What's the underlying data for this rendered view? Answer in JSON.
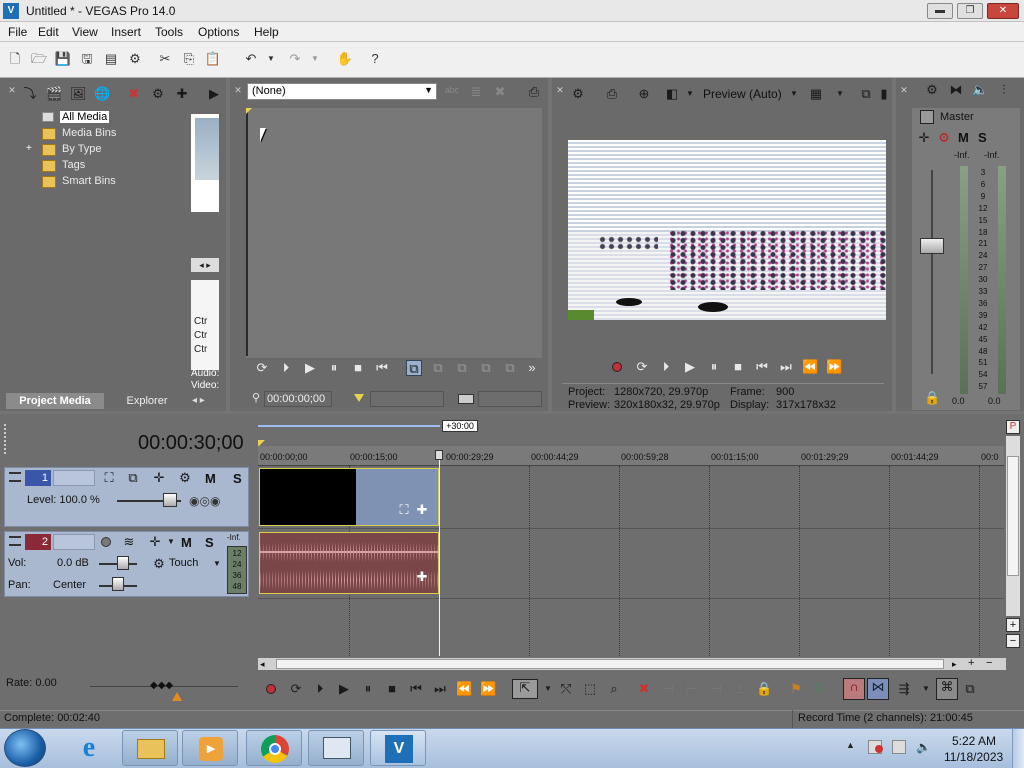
{
  "window": {
    "title": "Untitled * - VEGAS Pro 14.0",
    "logo": "V",
    "min": "▬",
    "max": "❐",
    "close": "✕"
  },
  "menu": [
    "File",
    "Edit",
    "View",
    "Insert",
    "Tools",
    "Options",
    "Help"
  ],
  "media": {
    "tree": [
      "All Media",
      "Media Bins",
      "By Type",
      "Tags",
      "Smart Bins"
    ],
    "expand": "+",
    "tabs": [
      "Project Media",
      "Explorer"
    ],
    "props": [
      "Ctr",
      "Ctr",
      "Ctr"
    ],
    "info": [
      "Audio:",
      "Video:"
    ]
  },
  "trimmer": {
    "dropdown": "(None)",
    "timecode": "00:00:00;00"
  },
  "preview": {
    "mode": "Preview (Auto)",
    "project_label": "Project:",
    "project_value": "1280x720, 29.970p",
    "preview_label": "Preview:",
    "preview_value": "320x180x32, 29.970p",
    "frame_label": "Frame:",
    "frame_value": "900",
    "display_label": "Display:",
    "display_value": "317x178x32"
  },
  "master": {
    "title": "Master",
    "m": "M",
    "s": "S",
    "inf_left": "-Inf.",
    "inf_right": "-Inf.",
    "scale": [
      "3",
      "6",
      "9",
      "12",
      "15",
      "18",
      "21",
      "24",
      "27",
      "30",
      "33",
      "36",
      "39",
      "42",
      "45",
      "48",
      "51",
      "54",
      "57"
    ],
    "bottom_left": "0.0",
    "bottom_right": "0.0"
  },
  "timeline": {
    "timecode": "00:00:30;00",
    "loop_region": "+30:00",
    "ruler": [
      "00:00:00;00",
      "00:00:15;00",
      "00:00:29;29",
      "00:00:44;29",
      "00:00:59;28",
      "00:01:15;00",
      "00:01:29;29",
      "00:01:44;29",
      "00:0"
    ]
  },
  "track1": {
    "number": "1",
    "level": "Level: 100.0 %",
    "m": "M",
    "s": "S"
  },
  "track2": {
    "number": "2",
    "vol_label": "Vol:",
    "vol_value": "0.0 dB",
    "pan_label": "Pan:",
    "pan_value": "Center",
    "automation": "Touch",
    "m": "M",
    "s": "S",
    "inf": "-Inf.",
    "scale": [
      "12",
      "24",
      "36",
      "48"
    ]
  },
  "transport": {
    "rate": "Rate: 0.00"
  },
  "status": {
    "left": "Complete: 00:02:40",
    "right": "Record Time (2 channels): 21:00:45"
  },
  "taskbar": {
    "time": "5:22 AM",
    "date": "11/18/2023"
  }
}
